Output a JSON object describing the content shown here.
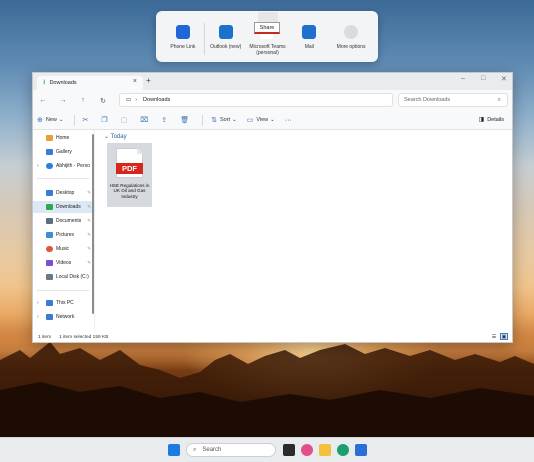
{
  "share_flyout": {
    "apps": [
      {
        "label": "Phone Link",
        "icon": "phone-link-icon",
        "color": "#2166d6"
      },
      {
        "label": "Outlook (new)",
        "icon": "outlook-icon",
        "color": "#1a73c8"
      },
      {
        "label": "Microsoft Teams (personal)",
        "icon": "teams-icon",
        "color": "#5b5fc7"
      },
      {
        "label": "Mail",
        "icon": "mail-icon",
        "color": "#1f6fcf"
      },
      {
        "label": "More options",
        "icon": "more-options-icon",
        "color": "#dcdcdc"
      }
    ],
    "tooltip": "Share"
  },
  "explorer": {
    "tab_title": "Downloads",
    "tab_close": "×",
    "new_tab": "+",
    "window_controls": {
      "minimize": "–",
      "maximize": "□",
      "close": "✕"
    },
    "nav": {
      "back": "←",
      "forward": "→",
      "up": "↑",
      "refresh": "↻"
    },
    "address": {
      "location_icon": "▭",
      "separator": "›",
      "crumb": "Downloads"
    },
    "search_placeholder": "Search Downloads",
    "commandbar": {
      "new_label": "New",
      "sort_label": "Sort",
      "view_label": "View",
      "more": "···",
      "details_label": "Details",
      "chevron": "⌄"
    },
    "sidebar": {
      "items": [
        {
          "label": "Home",
          "icon": "home-icon",
          "color": "#e6a13a"
        },
        {
          "label": "Gallery",
          "icon": "gallery-icon",
          "color": "#3a7bd5"
        },
        {
          "label": "Abhijith - Perso",
          "icon": "onedrive-icon",
          "color": "#2a7de1"
        },
        {
          "label": "Desktop",
          "icon": "desktop-icon",
          "color": "#3a7bd5"
        },
        {
          "label": "Downloads",
          "icon": "downloads-icon",
          "color": "#2fa84f"
        },
        {
          "label": "Documents",
          "icon": "documents-icon",
          "color": "#5a6e86"
        },
        {
          "label": "Pictures",
          "icon": "pictures-icon",
          "color": "#3a8fd8"
        },
        {
          "label": "Music",
          "icon": "music-icon",
          "color": "#e0583a"
        },
        {
          "label": "Videos",
          "icon": "videos-icon",
          "color": "#7a4fd0"
        },
        {
          "label": "Local Disk (C:)",
          "icon": "disk-icon",
          "color": "#6b7a89"
        },
        {
          "label": "This PC",
          "icon": "this-pc-icon",
          "color": "#3a7bd5"
        },
        {
          "label": "Network",
          "icon": "network-icon",
          "color": "#3a7bd5"
        }
      ],
      "pin": "✎",
      "chevron": "›"
    },
    "content": {
      "group_header": "⌄ Today",
      "files": [
        {
          "badge": "PDF",
          "name": "HSE Regulations in UK Oil and Gas Industry"
        }
      ]
    },
    "status": {
      "count": "1 item",
      "selected": "1 item selected 159 KB"
    }
  },
  "taskbar": {
    "search_placeholder": "Search",
    "search_icon": "⌕"
  }
}
